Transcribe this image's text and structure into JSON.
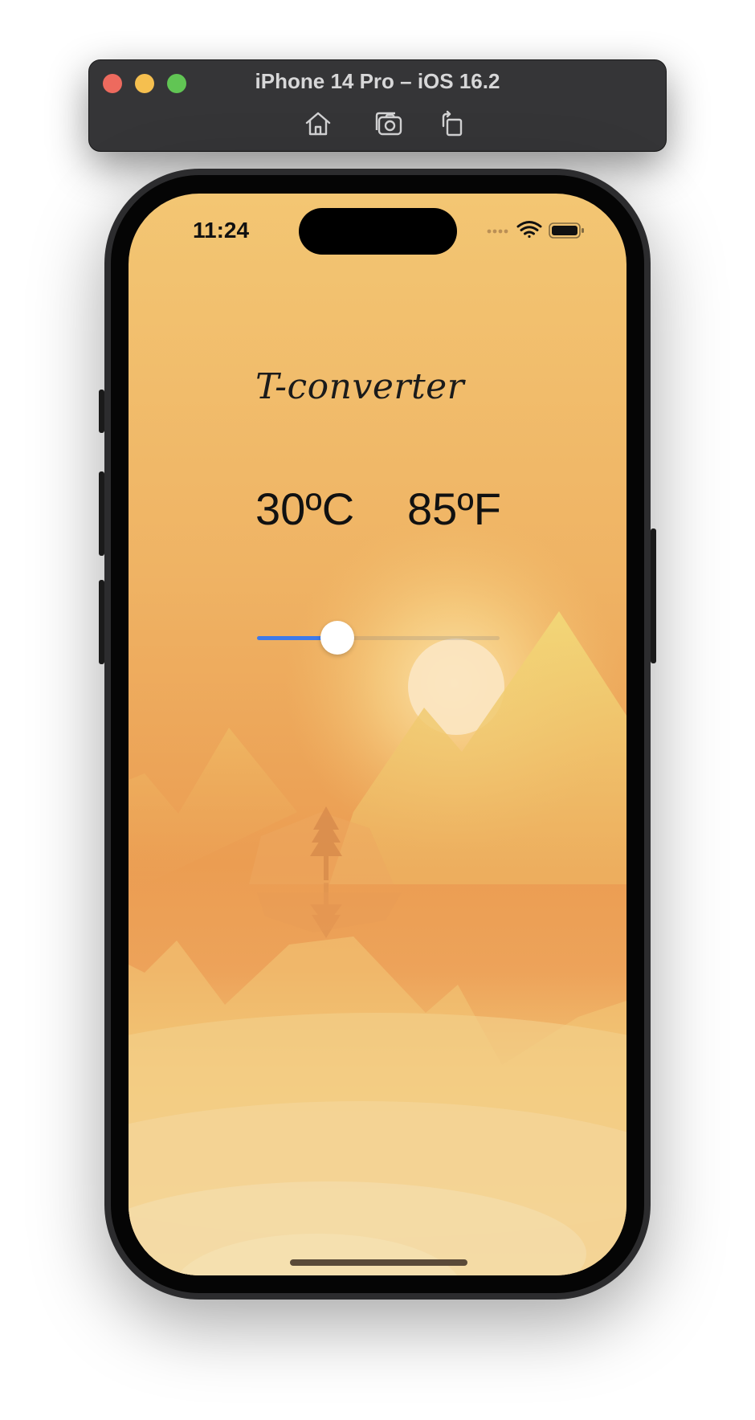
{
  "window": {
    "title": "iPhone 14 Pro – iOS 16.2",
    "toolbar": [
      "home-icon",
      "screenshot-icon",
      "rotate-icon"
    ]
  },
  "status_bar": {
    "time": "11:24",
    "icons": [
      "cellular-dots-icon",
      "wifi-icon",
      "battery-icon"
    ]
  },
  "app": {
    "title": "T-converter",
    "celsius": "30ºC",
    "fahrenheit": "85ºF",
    "slider": {
      "value": 0.33
    }
  },
  "colors": {
    "accent": "#3e7ae9",
    "sky_top": "#f3c673",
    "sky_mid": "#eca255",
    "sun": "#fbe6c2"
  }
}
